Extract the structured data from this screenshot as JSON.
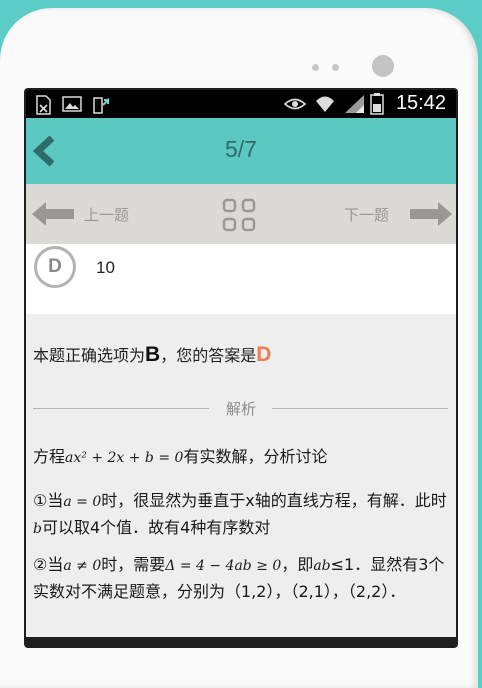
{
  "status_bar": {
    "time": "15:42",
    "left_icons": [
      "sim-off-icon",
      "image-icon",
      "upload-icon"
    ],
    "right_icons": [
      "eye-icon",
      "wifi-icon",
      "signal-icon",
      "battery-icon"
    ]
  },
  "header": {
    "back_icon": "chevron-left-icon",
    "page_indicator": "5/7"
  },
  "nav": {
    "prev_label": "上一题",
    "next_label": "下一题",
    "grid_icon": "grid-icon"
  },
  "option": {
    "letter": "D",
    "text": "10"
  },
  "answer": {
    "prefix": "本题正确选项为",
    "correct": "B",
    "middle": "，您的答案是",
    "user": "D"
  },
  "explanation": {
    "heading": "解析",
    "p1_prefix": "方程",
    "p1_math": "ax² + 2x + b = 0",
    "p1_suffix": "有实数解，分析讨论",
    "p2_prefix": "①当",
    "p2_math1": "a = 0",
    "p2_mid": "时，很显然为垂直于x轴的直线方程，有解．此时",
    "p2_math2": "b",
    "p2_suffix": "可以取4个值．故有4种有序数对",
    "p3_prefix": "②当",
    "p3_math1": "a ≠ 0",
    "p3_mid1": "时，需要",
    "p3_math2": "Δ = 4 − 4ab ≥ 0",
    "p3_mid2": "，即",
    "p3_math3": "ab",
    "p3_suffix": "≤1．显然有3个实数对不满足题意，分别为（1,2），（2,1），（2,2）．"
  },
  "colors": {
    "background": "#5ccdc6",
    "titlebar": "#5dc7c1",
    "user_answer": "#f07b55",
    "navbar": "#dcdad6"
  }
}
